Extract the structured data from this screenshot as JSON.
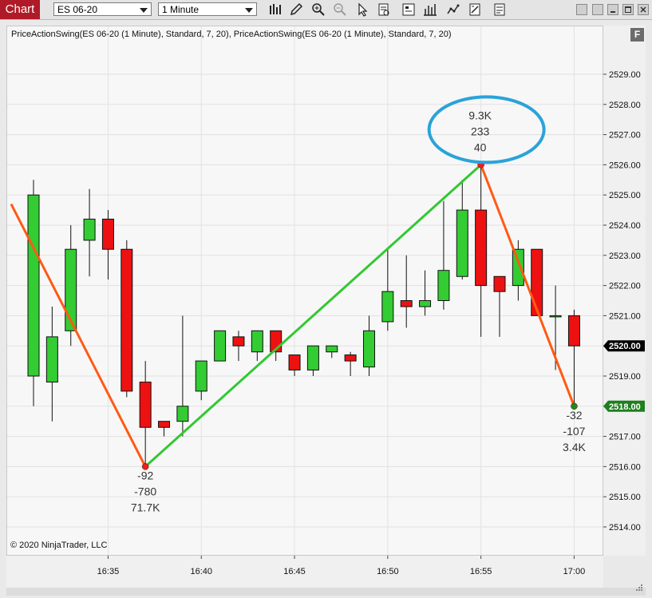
{
  "toolbar": {
    "chart_tab": "Chart",
    "instrument": "ES 06-20",
    "interval": "1 Minute",
    "icons": [
      "bar-chart-icon",
      "pencil-icon",
      "zoom-in-icon",
      "zoom-out-icon",
      "cursor-icon",
      "data-box-icon",
      "properties-icon",
      "strategies-icon",
      "indicators-icon",
      "chart-trader-icon",
      "more-icon"
    ]
  },
  "chart": {
    "indicator_label": "PriceActionSwing(ES 06-20 (1 Minute), Standard, 7, 20), PriceActionSwing(ES 06-20 (1 Minute), Standard, 7, 20)",
    "copyright": "© 2020 NinjaTrader, LLC",
    "f_badge": "F"
  },
  "chart_data": {
    "type": "candlestick",
    "ylim": [
      2513.2,
      2530
    ],
    "price_ticks": [
      "2529.00",
      "2528.00",
      "2527.00",
      "2526.00",
      "2525.00",
      "2524.00",
      "2523.00",
      "2522.00",
      "2521.00",
      "2520.00",
      "2519.00",
      "2518.00",
      "2517.00",
      "2516.00",
      "2515.00",
      "2514.00"
    ],
    "time_ticks": [
      "16:35",
      "16:40",
      "16:45",
      "16:50",
      "16:55",
      "17:00"
    ],
    "current_price": "2520.00",
    "swing_end_price": "2518.00",
    "candles": [
      {
        "o": 2519.0,
        "h": 2525.5,
        "l": 2518.0,
        "c": 2525.0
      },
      {
        "o": 2518.8,
        "h": 2521.3,
        "l": 2517.5,
        "c": 2520.3
      },
      {
        "o": 2520.5,
        "h": 2524.0,
        "l": 2520.0,
        "c": 2523.2
      },
      {
        "o": 2523.5,
        "h": 2525.2,
        "l": 2522.3,
        "c": 2524.2
      },
      {
        "o": 2524.2,
        "h": 2524.5,
        "l": 2522.2,
        "c": 2523.2
      },
      {
        "o": 2523.2,
        "h": 2523.5,
        "l": 2518.3,
        "c": 2518.5
      },
      {
        "o": 2518.8,
        "h": 2519.5,
        "l": 2516.0,
        "c": 2517.3
      },
      {
        "o": 2517.5,
        "h": 2517.5,
        "l": 2517.0,
        "c": 2517.3
      },
      {
        "o": 2517.5,
        "h": 2521.0,
        "l": 2517.0,
        "c": 2518.0
      },
      {
        "o": 2518.5,
        "h": 2519.5,
        "l": 2518.2,
        "c": 2519.5
      },
      {
        "o": 2519.5,
        "h": 2520.5,
        "l": 2519.5,
        "c": 2520.5
      },
      {
        "o": 2520.3,
        "h": 2520.5,
        "l": 2519.5,
        "c": 2520.0
      },
      {
        "o": 2519.8,
        "h": 2520.5,
        "l": 2519.5,
        "c": 2520.5
      },
      {
        "o": 2520.5,
        "h": 2520.5,
        "l": 2519.5,
        "c": 2519.8
      },
      {
        "o": 2519.7,
        "h": 2519.7,
        "l": 2519.0,
        "c": 2519.2
      },
      {
        "o": 2519.2,
        "h": 2520.0,
        "l": 2519.0,
        "c": 2520.0
      },
      {
        "o": 2519.8,
        "h": 2520.0,
        "l": 2519.6,
        "c": 2520.0
      },
      {
        "o": 2519.7,
        "h": 2519.8,
        "l": 2519.0,
        "c": 2519.5
      },
      {
        "o": 2519.3,
        "h": 2521.0,
        "l": 2519.0,
        "c": 2520.5
      },
      {
        "o": 2520.8,
        "h": 2523.2,
        "l": 2520.5,
        "c": 2521.8
      },
      {
        "o": 2521.5,
        "h": 2523.0,
        "l": 2520.6,
        "c": 2521.3
      },
      {
        "o": 2521.3,
        "h": 2522.5,
        "l": 2521.0,
        "c": 2521.5
      },
      {
        "o": 2521.5,
        "h": 2524.8,
        "l": 2521.2,
        "c": 2522.5
      },
      {
        "o": 2522.3,
        "h": 2525.5,
        "l": 2522.2,
        "c": 2524.5
      },
      {
        "o": 2524.5,
        "h": 2526.0,
        "l": 2520.3,
        "c": 2522.0
      },
      {
        "o": 2522.3,
        "h": 2522.3,
        "l": 2520.3,
        "c": 2521.8
      },
      {
        "o": 2522.0,
        "h": 2523.5,
        "l": 2521.5,
        "c": 2523.2
      },
      {
        "o": 2523.2,
        "h": 2523.2,
        "l": 2521.0,
        "c": 2521.0
      },
      {
        "o": 2521.0,
        "h": 2522.0,
        "l": 2519.2,
        "c": 2521.0
      },
      {
        "o": 2521.0,
        "h": 2521.2,
        "l": 2518.0,
        "c": 2520.0
      }
    ],
    "swings": [
      {
        "from_index": -1.2,
        "from_price": 2524.7,
        "to_index": 6,
        "to_price": 2516.0,
        "color": "#ff5a14"
      },
      {
        "from_index": 6,
        "from_price": 2516.0,
        "to_index": 24,
        "to_price": 2526.0,
        "color": "#32c832"
      },
      {
        "from_index": 24,
        "from_price": 2526.0,
        "to_index": 29,
        "to_price": 2518.0,
        "color": "#ff5a14"
      }
    ],
    "swing_points": [
      {
        "index": 6,
        "price": 2516.0,
        "color": "#e82020",
        "labels_below": [
          "-92",
          "-780",
          "71.7K"
        ]
      },
      {
        "index": 24,
        "price": 2526.0,
        "color": "#e82020",
        "labels_above": [
          "9.3K",
          "233",
          "40"
        ]
      },
      {
        "index": 29,
        "price": 2518.0,
        "color": "#1f8a1f",
        "labels_below": [
          "-32",
          "-107",
          "3.4K"
        ]
      }
    ]
  }
}
